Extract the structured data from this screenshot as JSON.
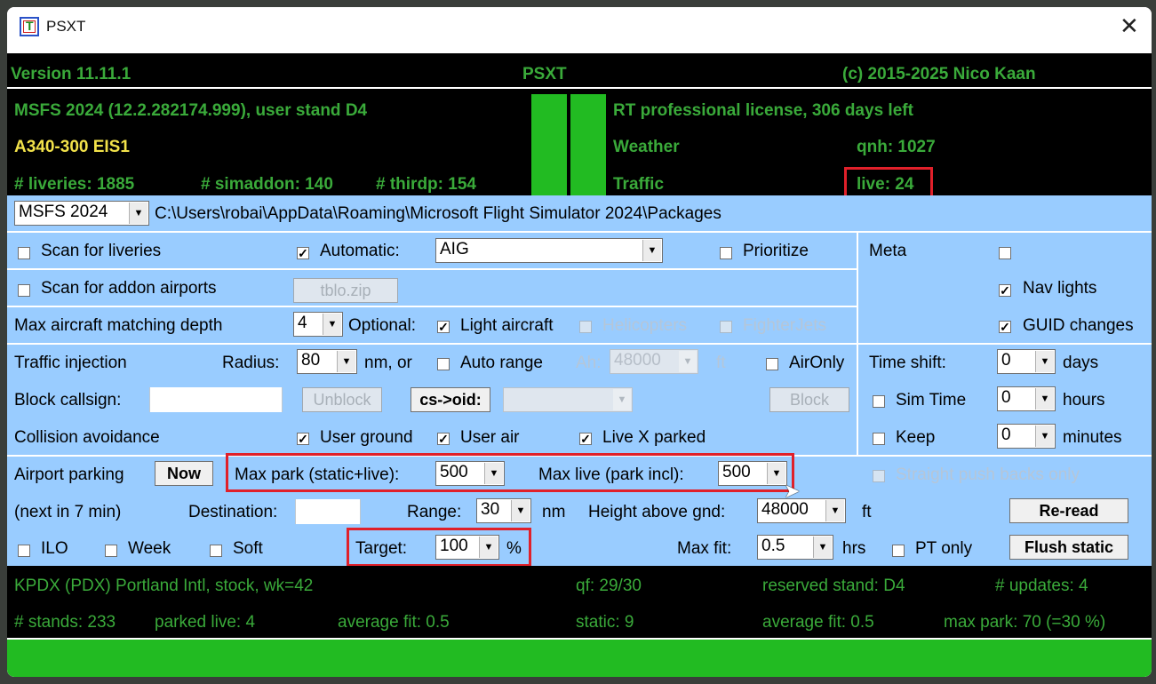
{
  "window": {
    "title": "PSXT",
    "app_icon": "T"
  },
  "header": {
    "version": "Version 11.11.1",
    "name": "PSXT",
    "copyright": "(c) 2015-2025 Nico Kaan"
  },
  "status": {
    "sim": "MSFS 2024 (12.2.282174.999), user stand D4",
    "aircraft": "A340-300 EIS1",
    "liveries": "# liveries: 1885",
    "simaddon": "# simaddon: 140",
    "thirdp": "# thirdp: 154",
    "license": "RT professional license, 306 days left",
    "weather": "Weather",
    "qnh": "qnh: 1027",
    "traffic": "Traffic",
    "live": "live:  24",
    "indicator_color": "#22bb22"
  },
  "path": {
    "sim_select": "MSFS 2024",
    "path": "C:\\Users\\robai\\AppData\\Roaming\\Microsoft Flight Simulator 2024\\Packages"
  },
  "row1": {
    "scan_liveries": "Scan for liveries",
    "automatic": "Automatic:",
    "auto_value": "AIG",
    "prioritize": "Prioritize",
    "meta": "Meta"
  },
  "row2": {
    "scan_airports": "Scan for addon airports",
    "tblo": "tblo.zip",
    "nav_lights": "Nav lights"
  },
  "row3": {
    "depth_label": "Max aircraft matching depth",
    "depth_value": "4",
    "optional": "Optional:",
    "light_aircraft": "Light aircraft",
    "helicopters": "Helicopters",
    "fighterjets": "FighterJets",
    "guid": "GUID changes"
  },
  "row4": {
    "injection": "Traffic injection",
    "radius_label": "Radius:",
    "radius_value": "80",
    "nm_or": "nm, or",
    "auto_range": "Auto range",
    "ah_label": "Ah:",
    "ah_value": "48000",
    "ft": "ft",
    "aironly": "AirOnly",
    "time_shift": "Time shift:",
    "days_value": "0",
    "days": "days"
  },
  "row5": {
    "block_callsign": "Block callsign:",
    "unblock": "Unblock",
    "cs_oid": "cs->oid:",
    "block": "Block",
    "sim_time": "Sim Time",
    "hours_value": "0",
    "hours": "hours"
  },
  "row6": {
    "collision": "Collision avoidance",
    "user_ground": "User ground",
    "user_air": "User air",
    "live_x_parked": "Live X parked",
    "keep": "Keep",
    "minutes_value": "0",
    "minutes": "minutes"
  },
  "row7": {
    "airport_parking": "Airport parking",
    "now": "Now",
    "max_park_label": "Max park (static+live):",
    "max_park_value": "500",
    "max_live_label": "Max live (park incl):",
    "max_live_value": "500",
    "straight_push": "Straight push backs only"
  },
  "row8": {
    "next": "(next in 7 min)",
    "destination": "Destination:",
    "range_label": "Range:",
    "range_value": "30",
    "nm": "nm",
    "height_label": "Height above gnd:",
    "height_value": "48000",
    "ft": "ft",
    "reread": "Re-read"
  },
  "row9": {
    "ilo": "ILO",
    "week": "Week",
    "soft": "Soft",
    "target_label": "Target:",
    "target_value": "100",
    "pct": "%",
    "maxfit_label": "Max fit:",
    "maxfit_value": "0.5",
    "hrs": "hrs",
    "pt_only": "PT only",
    "flush": "Flush static"
  },
  "bottom": {
    "airport": "KPDX (PDX)  Portland Intl, stock, wk=42",
    "qf": "qf: 29/30",
    "reserved": "reserved stand: D4",
    "updates": "# updates:    4",
    "stands": "# stands: 233",
    "parked_live": "parked live:   4",
    "avg_fit1": "average fit: 0.5",
    "static": "static:   9",
    "avg_fit2": "average fit: 0.5",
    "max_park": "max park:  70 (=30 %)"
  },
  "checks": {
    "meta": false,
    "nav_lights": true,
    "guid": true,
    "automatic": true,
    "light_aircraft": true
  }
}
